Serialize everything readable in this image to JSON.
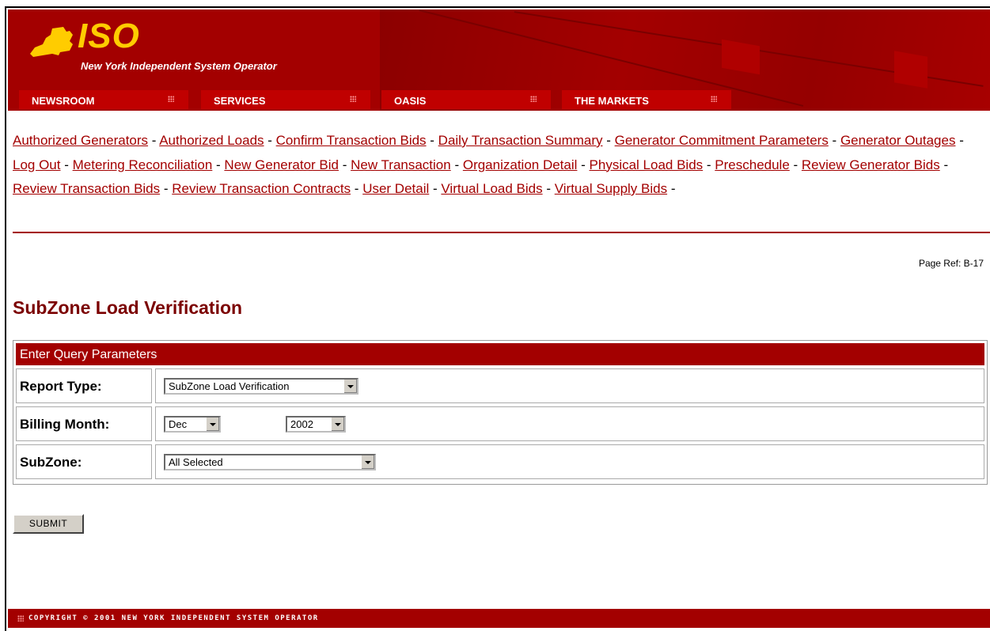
{
  "brand": {
    "logo_text": "ISO",
    "tagline": "New York Independent System Operator",
    "colors": {
      "primary": "#a30000",
      "accent": "#ffcc00",
      "link": "#a30000",
      "title": "#7b0000"
    }
  },
  "nav": {
    "tabs": [
      {
        "label": "NEWSROOM"
      },
      {
        "label": "SERVICES"
      },
      {
        "label": "OASIS"
      },
      {
        "label": "THE MARKETS"
      }
    ]
  },
  "links": [
    "Authorized Generators",
    "Authorized Loads",
    "Confirm Transaction Bids",
    "Daily Transaction Summary",
    "Generator Commitment Parameters",
    "Generator Outages",
    "Log Out",
    "Metering Reconciliation",
    "New Generator Bid",
    "New Transaction",
    "Organization Detail",
    "Physical Load Bids",
    "Preschedule",
    "Review Generator Bids",
    "Review Transaction Bids",
    "Review Transaction Contracts",
    "User Detail",
    "Virtual Load Bids",
    "Virtual Supply Bids"
  ],
  "link_separator": " - ",
  "page_ref": "Page Ref: B-17",
  "page_title": "SubZone Load Verification",
  "query": {
    "header": "Enter Query Parameters",
    "report_type": {
      "label": "Report Type:",
      "value": "SubZone Load Verification"
    },
    "billing_month": {
      "label": "Billing Month:",
      "month": "Dec",
      "year": "2002"
    },
    "subzone": {
      "label": "SubZone:",
      "value": "All Selected"
    }
  },
  "submit_label": "SUBMIT",
  "footer": "COPYRIGHT © 2001 NEW YORK INDEPENDENT SYSTEM OPERATOR"
}
